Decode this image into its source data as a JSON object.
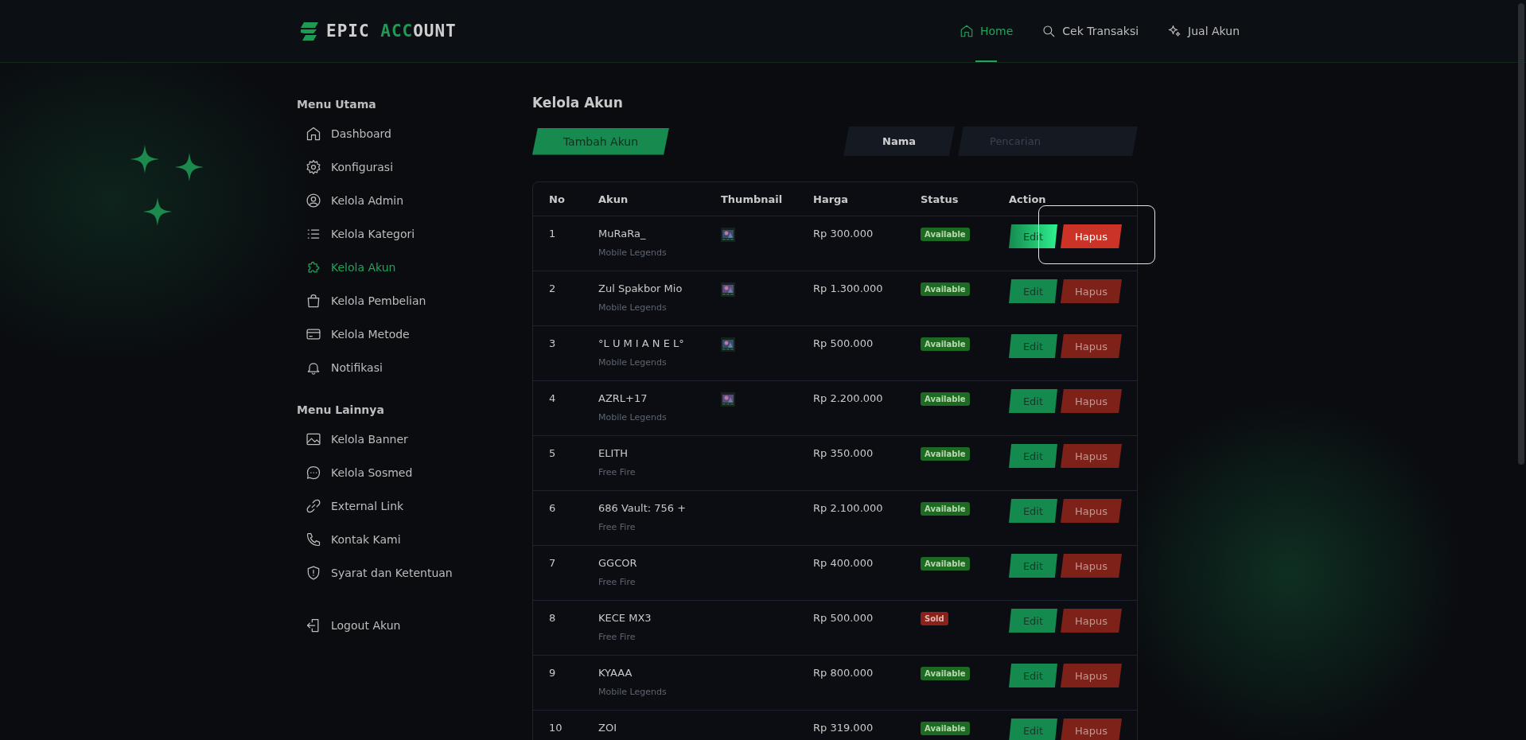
{
  "brand": {
    "part_1": "EPIC",
    "part_2": "ACC",
    "part_3": "OUNT"
  },
  "nav": [
    {
      "label": "Home",
      "selected": true
    },
    {
      "label": "Cek Transaksi",
      "selected": false
    },
    {
      "label": "Jual Akun",
      "selected": false
    }
  ],
  "sidebar": {
    "sections": [
      {
        "title": "Menu Utama",
        "items": [
          {
            "label": "Dashboard",
            "selected": false
          },
          {
            "label": "Konfigurasi",
            "selected": false
          },
          {
            "label": "Kelola Admin",
            "selected": false
          },
          {
            "label": "Kelola Kategori",
            "selected": false
          },
          {
            "label": "Kelola Akun",
            "selected": true
          },
          {
            "label": "Kelola Pembelian",
            "selected": false
          },
          {
            "label": "Kelola Metode",
            "selected": false
          },
          {
            "label": "Notifikasi",
            "selected": false
          }
        ]
      },
      {
        "title": "Menu Lainnya",
        "items": [
          {
            "label": "Kelola Banner",
            "selected": false
          },
          {
            "label": "Kelola Sosmed",
            "selected": false
          },
          {
            "label": "External Link",
            "selected": false
          },
          {
            "label": "Kontak Kami",
            "selected": false
          },
          {
            "label": "Syarat dan Ketentuan",
            "selected": false
          }
        ]
      }
    ],
    "logout": "Logout Akun"
  },
  "page_title": "Kelola Akun",
  "add_button": "Tambah Akun",
  "filter": {
    "label": "Nama",
    "placeholder": "Pencarian"
  },
  "table": {
    "columns": [
      "No",
      "Akun",
      "Thumbnail",
      "Harga",
      "Status",
      "Action"
    ],
    "rows": [
      {
        "no": "1",
        "name": "MuRaRa_",
        "game": "Mobile Legends",
        "price": "Rp 300.000",
        "status": "Available",
        "color": "#1d6b22",
        "edit": "Edit",
        "delete": "Hapus",
        "hovered": true
      },
      {
        "no": "2",
        "name": "Zul Spakbor Mio",
        "game": "Mobile Legends",
        "price": "Rp 1.300.000",
        "status": "Available",
        "color": "#1d6b22",
        "edit": "Edit",
        "delete": "Hapus",
        "hovered": false
      },
      {
        "no": "3",
        "name": "°L U M I A N E L°",
        "game": "Mobile Legends",
        "price": "Rp 500.000",
        "status": "Available",
        "color": "#1d6b22",
        "edit": "Edit",
        "delete": "Hapus",
        "hovered": false
      },
      {
        "no": "4",
        "name": "AZRL+17",
        "game": "Mobile Legends",
        "price": "Rp 2.200.000",
        "status": "Available",
        "color": "#1d6b22",
        "edit": "Edit",
        "delete": "Hapus",
        "hovered": false
      },
      {
        "no": "5",
        "name": "ELITH",
        "game": "Free Fire",
        "price": "Rp 350.000",
        "status": "Available",
        "color": "#1d6b22",
        "edit": "Edit",
        "delete": "Hapus",
        "hovered": false
      },
      {
        "no": "6",
        "name": "686 Vault: 756 +",
        "game": "Free Fire",
        "price": "Rp 2.100.000",
        "status": "Available",
        "color": "#1d6b22",
        "edit": "Edit",
        "delete": "Hapus",
        "hovered": false
      },
      {
        "no": "7",
        "name": "GGCOR",
        "game": "Free Fire",
        "price": "Rp 400.000",
        "status": "Available",
        "color": "#1d6b22",
        "edit": "Edit",
        "delete": "Hapus",
        "hovered": false
      },
      {
        "no": "8",
        "name": "KECE MX3",
        "game": "Free Fire",
        "price": "Rp 500.000",
        "status": "Sold",
        "color": "#8b2219",
        "edit": "Edit",
        "delete": "Hapus",
        "hovered": false
      },
      {
        "no": "9",
        "name": "KYAAA",
        "game": "Mobile Legends",
        "price": "Rp 800.000",
        "status": "Available",
        "color": "#1d6b22",
        "edit": "Edit",
        "delete": "Hapus",
        "hovered": false
      },
      {
        "no": "10",
        "name": "ZOI",
        "price": "Rp 319.000",
        "status": "Available",
        "color": "#1d6b22",
        "edit": "Edit",
        "delete": "Hapus",
        "hovered": false
      }
    ]
  }
}
